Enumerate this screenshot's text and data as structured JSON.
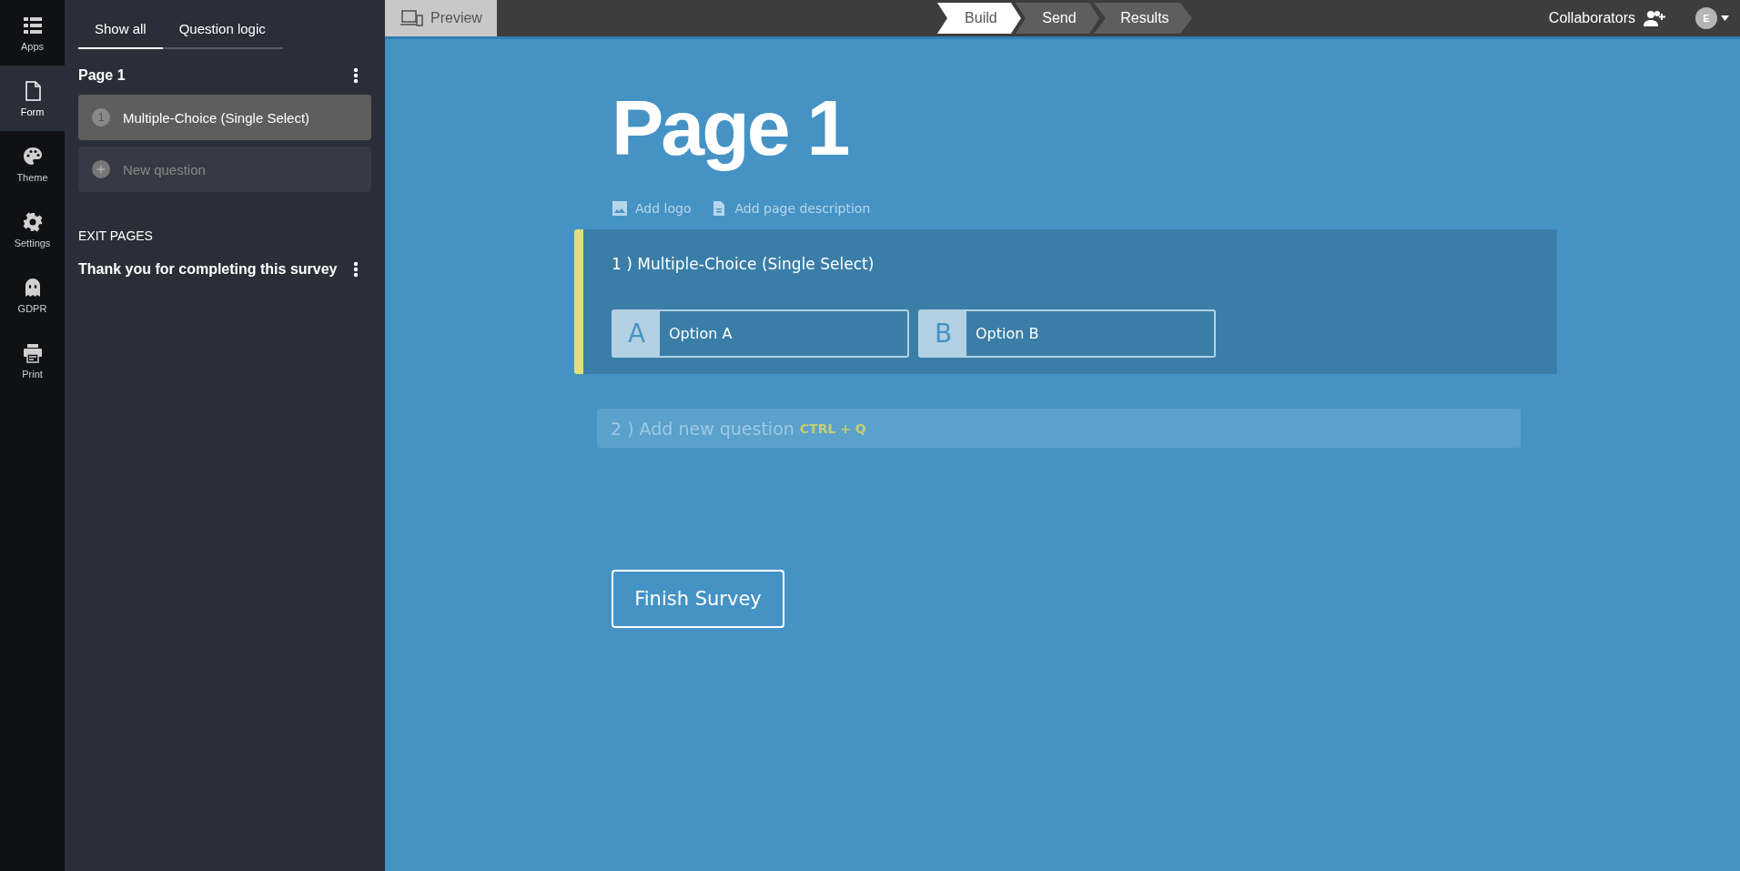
{
  "nav_rail": [
    {
      "label": "Apps",
      "kind": "apps",
      "selected": false
    },
    {
      "label": "Form",
      "kind": "form",
      "selected": true
    },
    {
      "label": "Theme",
      "kind": "palette",
      "selected": false
    },
    {
      "label": "Settings",
      "kind": "gear",
      "selected": false
    },
    {
      "label": "GDPR",
      "kind": "ghost",
      "selected": false
    },
    {
      "label": "Print",
      "kind": "printer",
      "selected": false
    }
  ],
  "sidebar": {
    "tabs": [
      {
        "label": "Show all",
        "selected": true
      },
      {
        "label": "Question logic",
        "selected": false
      }
    ],
    "page_title": "Page 1",
    "questions": [
      {
        "number": "1",
        "label": "Multiple-Choice (Single Select)",
        "kind": "question",
        "selected": true
      },
      {
        "label": "New question",
        "kind": "add",
        "selected": false
      }
    ],
    "exit_heading": "EXIT PAGES",
    "exit_pages": [
      "Thank you for completing this survey"
    ]
  },
  "top_bar": {
    "preview": "Preview",
    "steps": [
      {
        "label": "Build",
        "selected": true
      },
      {
        "label": "Send",
        "selected": false
      },
      {
        "label": "Results",
        "selected": false
      }
    ],
    "collaborators": "Collaborators",
    "avatar": "E"
  },
  "page": {
    "title": "Page 1",
    "add_logo": "Add logo",
    "add_description": "Add page description",
    "question": {
      "number": "1 )",
      "title": "Multiple-Choice (Single Select)",
      "selected": true,
      "options": [
        {
          "letter": "A",
          "label": "Option A"
        },
        {
          "letter": "B",
          "label": "Option B"
        }
      ]
    },
    "add_question": {
      "number": "2 )",
      "label": "Add new question",
      "shortcut": "CTRL + Q"
    },
    "finish_button": "Finish Survey"
  }
}
